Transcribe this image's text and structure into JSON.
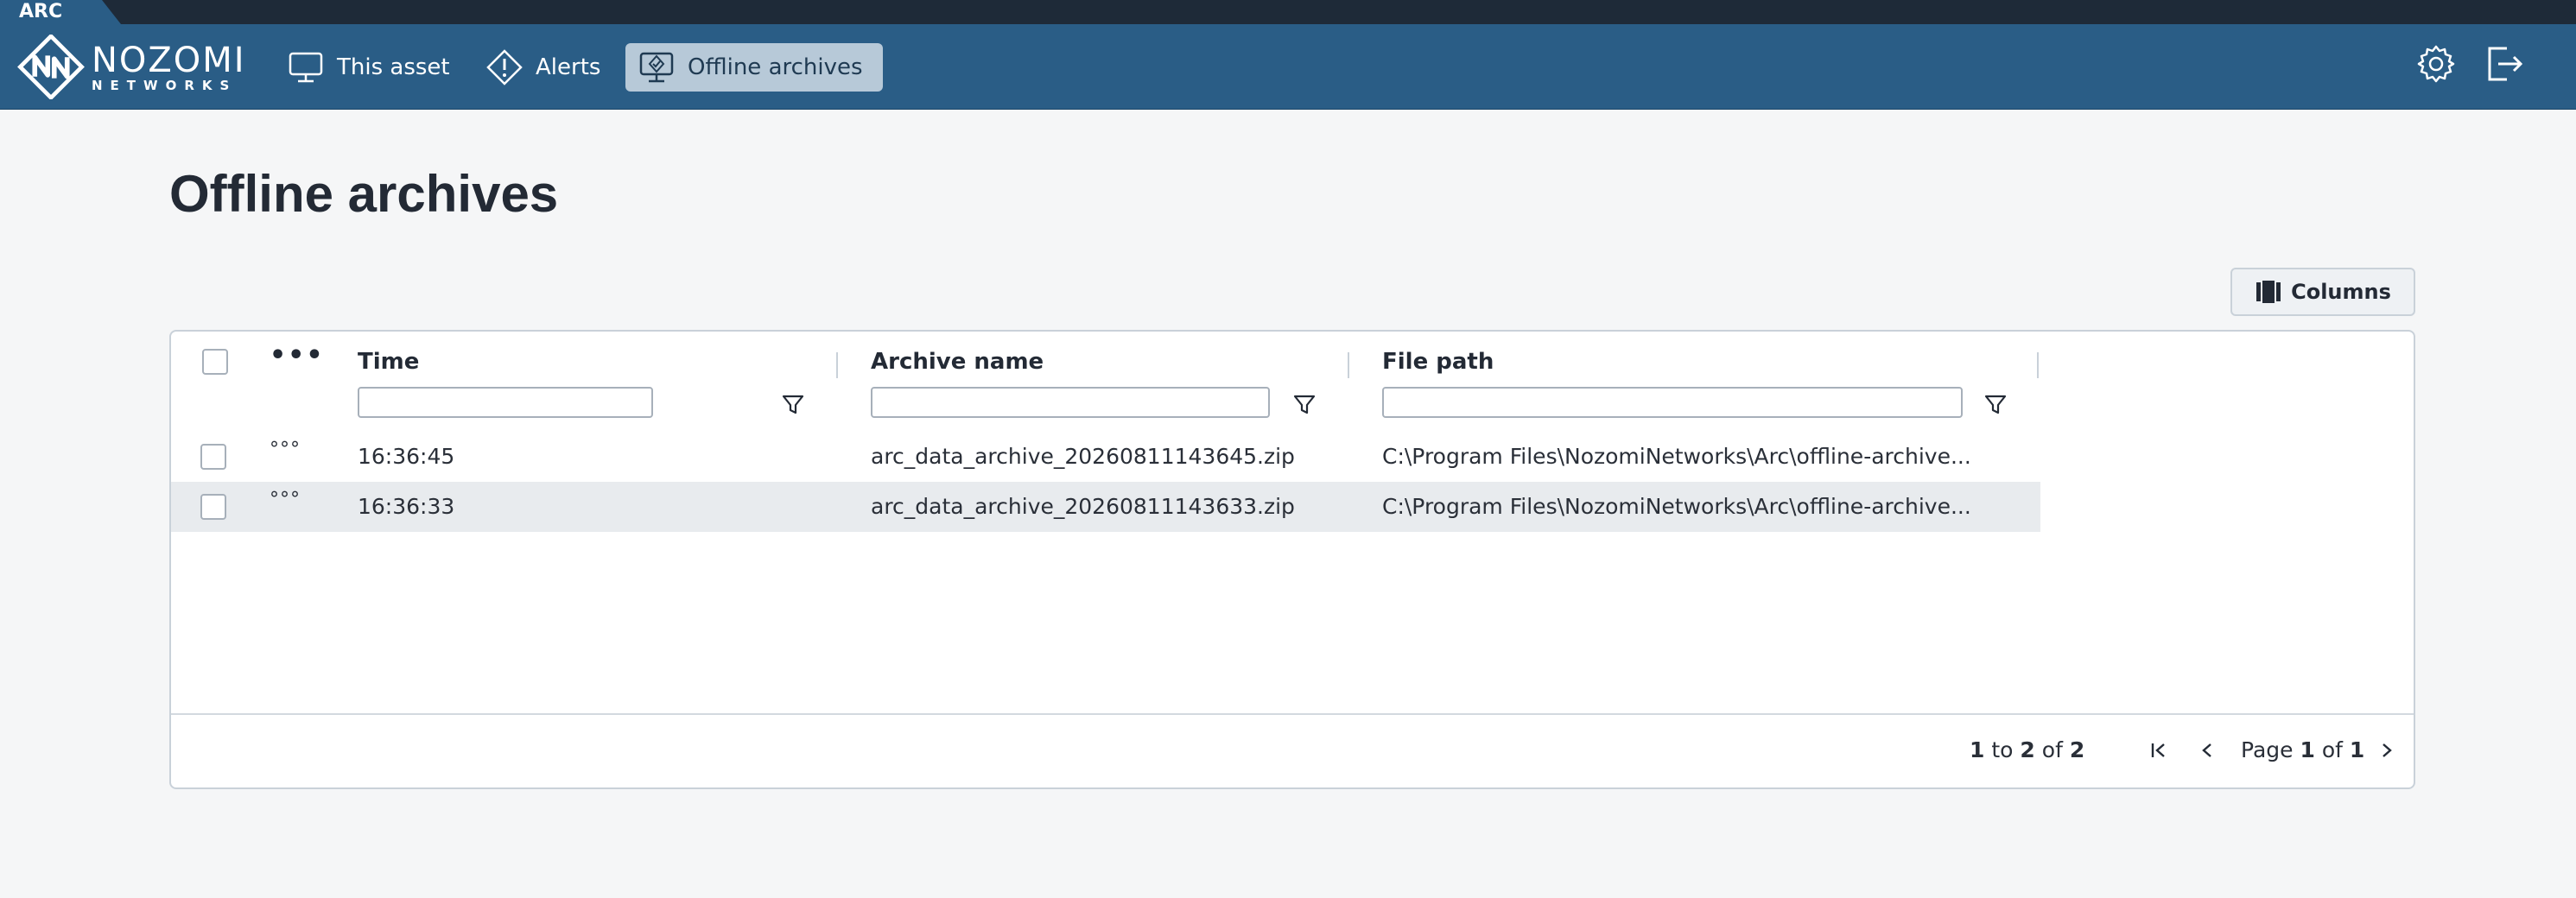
{
  "app": {
    "tab_label": "ARC",
    "brand_line1": "NOZOMI",
    "brand_line2": "NETWORKS"
  },
  "nav": {
    "items": [
      {
        "label": "This asset",
        "icon": "monitor-icon",
        "active": false
      },
      {
        "label": "Alerts",
        "icon": "alert-diamond-icon",
        "active": false
      },
      {
        "label": "Offline archives",
        "icon": "archive-monitor-icon",
        "active": true
      }
    ],
    "right_icons": [
      "gear-icon",
      "logout-icon"
    ]
  },
  "page": {
    "title": "Offline archives"
  },
  "toolbar": {
    "columns_label": "Columns"
  },
  "table": {
    "columns": [
      "Time",
      "Archive name",
      "File path"
    ],
    "rows": [
      {
        "time": "16:36:45",
        "archive_name": "arc_data_archive_20260811143645.zip",
        "file_path": "C:\\Program Files\\NozomiNetworks\\Arc\\offline-archive..."
      },
      {
        "time": "16:36:33",
        "archive_name": "arc_data_archive_20260811143633.zip",
        "file_path": "C:\\Program Files\\NozomiNetworks\\Arc\\offline-archive..."
      }
    ]
  },
  "pagination": {
    "from": "1",
    "to_word": "to",
    "to": "2",
    "of_word": "of",
    "total": "2",
    "page_word": "Page",
    "page": "1",
    "page_of_word": "of",
    "page_total": "1"
  },
  "colors": {
    "navbar": "#2a5d86",
    "active_nav": "#b7c9d8",
    "background": "#f5f6f7",
    "alt_row": "#e8ebee"
  }
}
